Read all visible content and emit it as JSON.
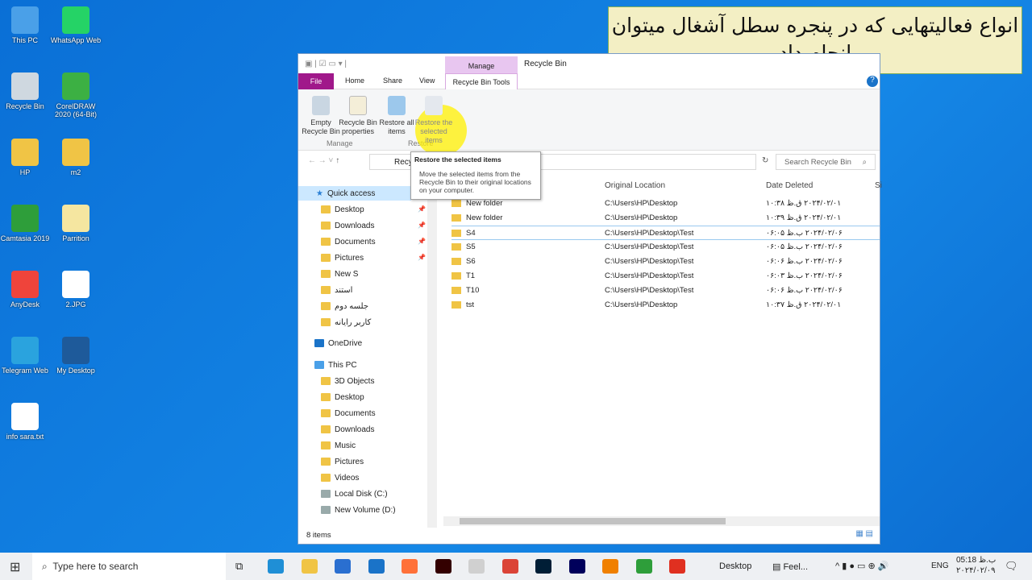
{
  "desktop_icons": [
    {
      "label": "This PC",
      "color": "#4aa0e8"
    },
    {
      "label": "WhatsApp Web",
      "color": "#25d366"
    },
    {
      "label": "Recycle Bin",
      "color": "#cfd8e0"
    },
    {
      "label": "CorelDRAW 2020 (64-Bit)",
      "color": "#3cb043"
    },
    {
      "label": "HP",
      "color": "#f0c445"
    },
    {
      "label": "m2",
      "color": "#f0c445"
    },
    {
      "label": "Camtasia 2019",
      "color": "#2e9e3a"
    },
    {
      "label": "Parrition",
      "color": "#f5e6a0"
    },
    {
      "label": "AnyDesk",
      "color": "#ef443b"
    },
    {
      "label": "2.JPG",
      "color": "#ffffff"
    },
    {
      "label": "Telegram Web",
      "color": "#2aa3de"
    },
    {
      "label": "My Desktop",
      "color": "#1e5a9a"
    },
    {
      "label": "info sara.txt",
      "color": "#ffffff"
    }
  ],
  "banner": "انواع فعالیتهایی که در پنجره سطل آشغال میتوان انجام داد",
  "window": {
    "title": "Recycle Bin",
    "context_tab": "Manage",
    "tabs": {
      "file": "File",
      "home": "Home",
      "share": "Share",
      "view": "View",
      "tools": "Recycle Bin Tools"
    },
    "ribbon": {
      "empty": "Empty Recycle Bin",
      "props": "Recycle Bin properties",
      "restore_all": "Restore all items",
      "restore_sel": "Restore the selected items",
      "group_manage": "Manage",
      "group_restore": "Restore"
    },
    "address": "Recy",
    "search_placeholder": "Search Recycle Bin",
    "tooltip": {
      "title": "Restore the selected items",
      "body": "Move the selected items from the Recycle Bin to their original locations on your computer."
    },
    "nav": {
      "quick_access": "Quick access",
      "quick": [
        "Desktop",
        "Downloads",
        "Documents",
        "Pictures",
        "New S",
        "استند",
        "جلسه دوم",
        "کاربر رایانه"
      ],
      "onedrive": "OneDrive",
      "thispc": "This PC",
      "pc": [
        "3D Objects",
        "Desktop",
        "Documents",
        "Downloads",
        "Music",
        "Pictures",
        "Videos",
        "Local Disk (C:)",
        "New Volume (D:)"
      ]
    },
    "columns": {
      "name": "Name",
      "location": "Original Location",
      "date": "Date Deleted",
      "size": "Si"
    },
    "rows": [
      {
        "name": "New folder",
        "location": "C:\\Users\\HP\\Desktop",
        "date": "۲۰۲۴/۰۲/۰۱ ق.ظ ۱۰:۳۸"
      },
      {
        "name": "New folder",
        "location": "C:\\Users\\HP\\Desktop",
        "date": "۲۰۲۴/۰۲/۰۱ ق.ظ ۱۰:۳۹"
      },
      {
        "name": "S4",
        "location": "C:\\Users\\HP\\Desktop\\Test",
        "date": "۲۰۲۴/۰۲/۰۶ ب.ظ ۰۶:۰۵"
      },
      {
        "name": "S5",
        "location": "C:\\Users\\HP\\Desktop\\Test",
        "date": "۲۰۲۴/۰۲/۰۶ ب.ظ ۰۶:۰۵"
      },
      {
        "name": "S6",
        "location": "C:\\Users\\HP\\Desktop\\Test",
        "date": "۲۰۲۴/۰۲/۰۶ ب.ظ ۰۶:۰۶"
      },
      {
        "name": "T1",
        "location": "C:\\Users\\HP\\Desktop\\Test",
        "date": "۲۰۲۴/۰۲/۰۶ ب.ظ ۰۶:۰۳"
      },
      {
        "name": "T10",
        "location": "C:\\Users\\HP\\Desktop\\Test",
        "date": "۲۰۲۴/۰۲/۰۶ ب.ظ ۰۶:۰۶"
      },
      {
        "name": "tst",
        "location": "C:\\Users\\HP\\Desktop",
        "date": "۲۰۲۴/۰۲/۰۱ ق.ظ ۱۰:۳۷"
      }
    ],
    "status": "8 items"
  },
  "taskbar": {
    "search_placeholder": "Type here to search",
    "desktop": "Desktop",
    "news": "Feel...",
    "lang": "ENG",
    "time": "05:18 ب.ظ",
    "date": "۲۰۲۴/۰۲/۰۹",
    "apps": [
      {
        "name": "edge",
        "color": "#1f8fd6"
      },
      {
        "name": "explorer",
        "color": "#f0c445"
      },
      {
        "name": "store",
        "color": "#2a6fd0"
      },
      {
        "name": "mail",
        "color": "#1a73c8"
      },
      {
        "name": "firefox",
        "color": "#ff7139"
      },
      {
        "name": "illustrator",
        "color": "#330000"
      },
      {
        "name": "paint",
        "color": "#d0d0d0"
      },
      {
        "name": "chrome",
        "color": "#db4437"
      },
      {
        "name": "photoshop",
        "color": "#001e36"
      },
      {
        "name": "premiere",
        "color": "#00005b"
      },
      {
        "name": "vlc",
        "color": "#f08000"
      },
      {
        "name": "camtasia",
        "color": "#2e9e3a"
      },
      {
        "name": "camtasia-recorder",
        "color": "#e03020"
      }
    ]
  }
}
